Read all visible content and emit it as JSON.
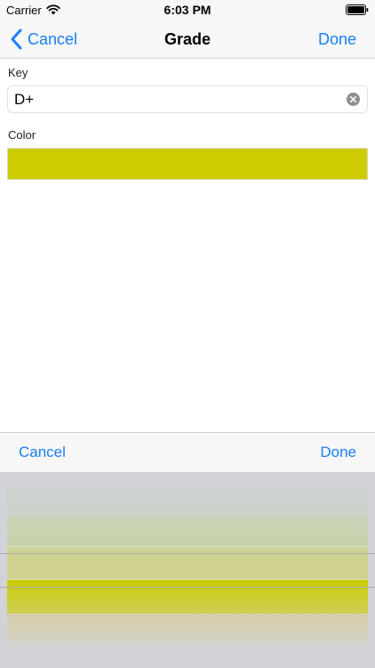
{
  "status_bar": {
    "carrier": "Carrier",
    "time": "6:03 PM"
  },
  "nav": {
    "back_label": "Cancel",
    "title": "Grade",
    "done_label": "Done"
  },
  "form": {
    "key_label": "Key",
    "key_value": "D+",
    "color_label": "Color",
    "selected_color": "#cccc00"
  },
  "picker_toolbar": {
    "cancel_label": "Cancel",
    "done_label": "Done"
  },
  "picker": {
    "options": [
      {
        "color": "#a9d17a"
      },
      {
        "color": "#bcd37e"
      },
      {
        "color": "#cfd282"
      },
      {
        "color": "#cccc00"
      },
      {
        "color": "#d9c983"
      },
      {
        "color": "#dcbf8a"
      },
      {
        "color": "#dfb494"
      }
    ],
    "selected_index": 3
  },
  "colors": {
    "accent": "#1a7ff5"
  }
}
